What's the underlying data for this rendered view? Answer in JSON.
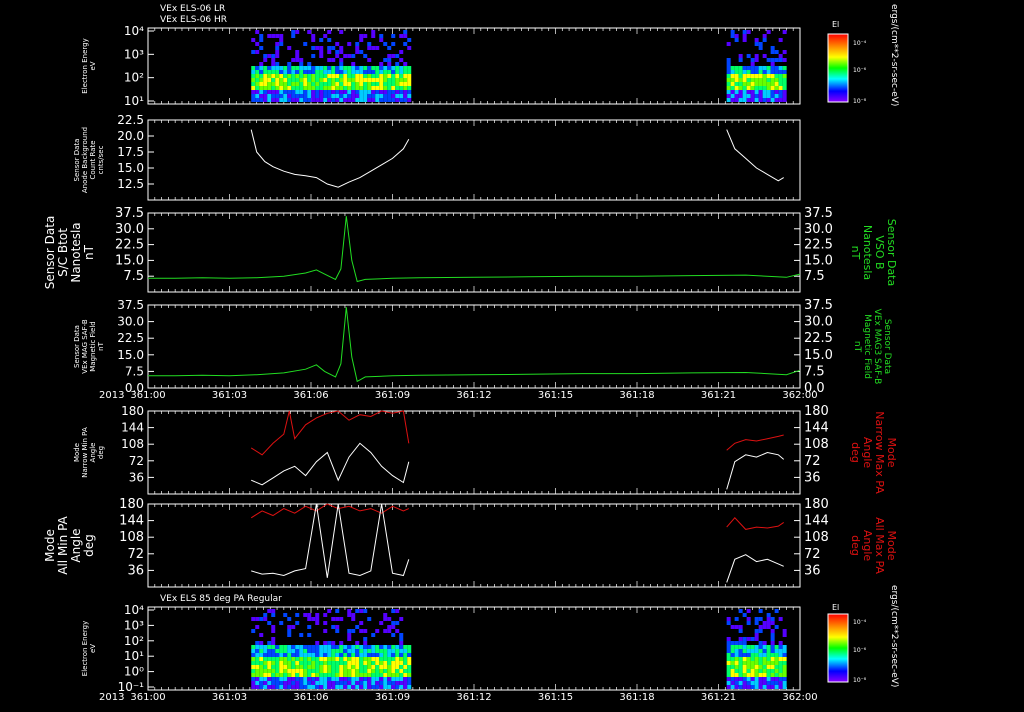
{
  "colors": {
    "background": "#000000",
    "axis": "#ffffff",
    "white_trace": "#ffffff",
    "green_trace": "#22dd22",
    "red_trace": "#dd1111",
    "label_green": "#22dd22",
    "label_red": "#dd1111"
  },
  "header": {
    "title_lr": "VEx ELS-06 LR",
    "title_hr": "VEx ELS-06 HR",
    "title_85": "VEx ELS 85 deg PA Regular"
  },
  "time_axis": {
    "start": "361:00",
    "end": "362:00",
    "tick_labels": [
      "361:00",
      "361:03",
      "361:06",
      "361:09",
      "361:12",
      "361:15",
      "361:18",
      "361:21",
      "362:00"
    ],
    "year": "2013",
    "data_gaps": [
      [
        "361:10",
        "361:21"
      ]
    ]
  },
  "colorbar": {
    "title": "El",
    "tick_labels": [
      "10⁻⁴",
      "10⁻⁶",
      "10⁻⁸"
    ],
    "unit_label": "ergs/(cm**2-sr-sec-eV)",
    "colors": [
      "#ff0000",
      "#ff8800",
      "#ffff00",
      "#00ff00",
      "#00ffff",
      "#0000ff",
      "#8800ff"
    ]
  },
  "chart_data": [
    {
      "id": "spectrogram-top",
      "type": "heatmap",
      "title": "VEx ELS-06 LR / VEx ELS-06 HR",
      "ylabel": [
        "Electron Energy",
        "eV"
      ],
      "ytick_labels": [
        "10⁴",
        "10³",
        "10²",
        "10¹"
      ],
      "y_scale": "log",
      "ylim": [
        1,
        10000
      ],
      "data_intervals": [
        [
          "361:03.8",
          "361:09.6"
        ],
        [
          "361:21.3",
          "361:23.4"
        ]
      ]
    },
    {
      "id": "anode-bg",
      "type": "line",
      "ylabel": [
        "Sensor Data",
        "Anode Background",
        "Count Rate",
        "cnts/sec"
      ],
      "ytick_labels": [
        "22.5",
        "20.0",
        "17.5",
        "15.0",
        "12.5"
      ],
      "ylim": [
        10,
        22.5
      ],
      "series": [
        {
          "color": "white",
          "x": [
            3.8,
            4.0,
            4.3,
            4.6,
            5.0,
            5.4,
            5.8,
            6.2,
            6.6,
            7.0,
            7.4,
            7.8,
            8.2,
            8.6,
            9.0,
            9.4,
            9.6
          ],
          "y": [
            21.0,
            17.5,
            16.0,
            15.2,
            14.5,
            14.0,
            13.8,
            13.5,
            12.5,
            12.0,
            12.8,
            13.5,
            14.5,
            15.5,
            16.5,
            18.0,
            19.5
          ]
        },
        {
          "color": "white",
          "x": [
            21.3,
            21.6,
            22.0,
            22.4,
            22.8,
            23.2,
            23.4
          ],
          "y": [
            21.0,
            18.0,
            16.5,
            15.0,
            14.0,
            13.0,
            13.5
          ]
        }
      ]
    },
    {
      "id": "bmag-panel",
      "type": "line",
      "ylabel": [
        "Sensor Data",
        "S/C Btot",
        "Nanotesla",
        "nT"
      ],
      "ylabel_right": [
        "Sensor Data",
        "VSO B",
        "Nanotesla",
        "nT"
      ],
      "ytick_labels": [
        "37.5",
        "30.0",
        "22.5",
        "15.0",
        "7.5"
      ],
      "ylim": [
        0,
        37.5
      ],
      "series": [
        {
          "color": "green",
          "x": [
            0.0,
            1,
            2,
            3,
            4,
            5,
            5.8,
            6.2,
            6.5,
            6.9,
            7.1,
            7.3,
            7.5,
            7.7,
            8.0,
            9,
            10,
            12,
            14,
            16,
            18,
            20,
            22,
            23.5,
            24.0
          ],
          "y": [
            6.5,
            6.5,
            6.8,
            6.5,
            6.8,
            7.5,
            9.0,
            10.5,
            8.5,
            6.0,
            11.0,
            36.0,
            15.0,
            5.0,
            6.0,
            6.5,
            6.8,
            7.0,
            7.2,
            7.5,
            7.5,
            7.8,
            8.0,
            7.0,
            8.5
          ]
        }
      ]
    },
    {
      "id": "mag3-panel",
      "type": "line",
      "ylabel": [
        "Sensor Data",
        "VEx MAG SAF-B",
        "Magnetic Field",
        "nT"
      ],
      "ylabel_right": [
        "Sensor Data",
        "VEx MAG3 SAF-B",
        "Magnetic Field",
        "nT"
      ],
      "ytick_labels": [
        "37.5",
        "30.0",
        "22.5",
        "15.0",
        "7.5",
        "0.0"
      ],
      "ylim": [
        0,
        37.5
      ],
      "series": [
        {
          "color": "green",
          "x": [
            0.0,
            1,
            2,
            3,
            4,
            5,
            5.8,
            6.2,
            6.5,
            6.9,
            7.1,
            7.3,
            7.5,
            7.7,
            8.0,
            9,
            10,
            12,
            14,
            16,
            18,
            20,
            22,
            23.5,
            24.0
          ],
          "y": [
            5.5,
            5.5,
            5.8,
            5.5,
            6.0,
            6.8,
            8.5,
            10.5,
            7.5,
            5.0,
            11.0,
            36.5,
            14.0,
            3.0,
            5.0,
            5.5,
            5.8,
            6.0,
            6.2,
            6.5,
            6.5,
            6.8,
            7.0,
            6.0,
            8.0
          ]
        }
      ]
    },
    {
      "id": "narrow-pa",
      "type": "line",
      "ylabel": [
        "Mode",
        "Narrow Min PA",
        "Angle",
        "deg"
      ],
      "ylabel_right": [
        "Mode",
        "Narrow Max PA",
        "Angle",
        "deg"
      ],
      "ytick_labels": [
        "180",
        "144",
        "108",
        "72",
        "36"
      ],
      "ylim": [
        0,
        180
      ],
      "series": [
        {
          "name": "Narrow Max PA",
          "color": "red",
          "x": [
            3.8,
            4.2,
            4.6,
            5.0,
            5.2,
            5.4,
            5.8,
            6.2,
            6.6,
            7.0,
            7.4,
            7.8,
            8.2,
            8.6,
            9.0,
            9.4,
            9.6
          ],
          "y": [
            100,
            85,
            110,
            130,
            180,
            120,
            150,
            165,
            175,
            180,
            160,
            172,
            168,
            180,
            175,
            180,
            110
          ]
        },
        {
          "name": "Narrow Max PA",
          "color": "red",
          "x": [
            21.3,
            21.6,
            22.0,
            22.4,
            22.8,
            23.2,
            23.4
          ],
          "y": [
            95,
            110,
            118,
            115,
            120,
            125,
            128
          ]
        },
        {
          "name": "Narrow Min PA",
          "color": "white",
          "x": [
            3.8,
            4.2,
            4.6,
            5.0,
            5.4,
            5.8,
            6.2,
            6.6,
            7.0,
            7.4,
            7.8,
            8.2,
            8.6,
            9.0,
            9.4,
            9.6
          ],
          "y": [
            30,
            20,
            35,
            50,
            60,
            40,
            70,
            90,
            30,
            80,
            110,
            90,
            60,
            40,
            25,
            70
          ]
        },
        {
          "name": "Narrow Min PA",
          "color": "white",
          "x": [
            21.3,
            21.6,
            22.0,
            22.4,
            22.8,
            23.2,
            23.4
          ],
          "y": [
            10,
            70,
            85,
            80,
            90,
            85,
            75
          ]
        }
      ]
    },
    {
      "id": "all-pa",
      "type": "line",
      "ylabel": [
        "Mode",
        "All Min PA",
        "Angle",
        "deg"
      ],
      "ylabel_right": [
        "Mode",
        "All Max PA",
        "Angle",
        "deg"
      ],
      "ytick_labels": [
        "180",
        "144",
        "108",
        "72",
        "36"
      ],
      "ylim": [
        0,
        180
      ],
      "series": [
        {
          "name": "All Max PA",
          "color": "red",
          "x": [
            3.8,
            4.2,
            4.6,
            5.0,
            5.4,
            5.8,
            6.2,
            6.6,
            7.0,
            7.4,
            7.8,
            8.2,
            8.6,
            9.0,
            9.4,
            9.6
          ],
          "y": [
            150,
            165,
            155,
            170,
            160,
            175,
            165,
            180,
            170,
            175,
            165,
            170,
            160,
            175,
            165,
            170
          ]
        },
        {
          "name": "All Max PA",
          "color": "red",
          "x": [
            21.3,
            21.6,
            22.0,
            22.4,
            22.8,
            23.2,
            23.4
          ],
          "y": [
            130,
            150,
            125,
            130,
            128,
            132,
            140
          ]
        },
        {
          "name": "All Min PA",
          "color": "white",
          "x": [
            3.8,
            4.2,
            4.6,
            5.0,
            5.4,
            5.8,
            6.2,
            6.6,
            7.0,
            7.4,
            7.8,
            8.2,
            8.6,
            9.0,
            9.4,
            9.6
          ],
          "y": [
            35,
            28,
            30,
            25,
            35,
            40,
            180,
            20,
            180,
            30,
            25,
            35,
            180,
            30,
            25,
            60
          ]
        },
        {
          "name": "All Min PA",
          "color": "white",
          "x": [
            21.3,
            21.6,
            22.0,
            22.4,
            22.8,
            23.2,
            23.4
          ],
          "y": [
            10,
            60,
            70,
            55,
            60,
            50,
            45
          ]
        }
      ]
    },
    {
      "id": "spectrogram-bottom",
      "type": "heatmap",
      "title": "VEx ELS 85 deg PA Regular",
      "ylabel": [
        "Electron Energy",
        "eV"
      ],
      "ytick_labels": [
        "10⁴",
        "10³",
        "10²",
        "10¹",
        "10⁰",
        "10⁻¹"
      ],
      "y_scale": "log",
      "ylim": [
        0.1,
        10000
      ],
      "data_intervals": [
        [
          "361:03.8",
          "361:09.6"
        ],
        [
          "361:21.3",
          "361:23.4"
        ]
      ]
    }
  ]
}
